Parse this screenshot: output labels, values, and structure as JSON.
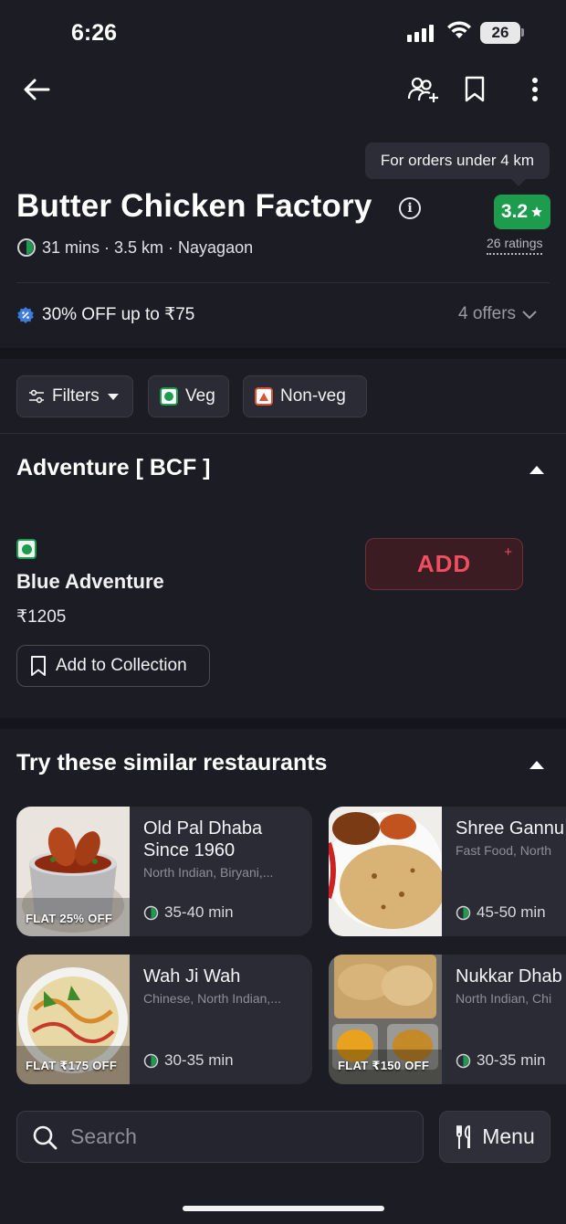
{
  "status_bar": {
    "time": "6:26",
    "battery": "26"
  },
  "tooltip": "For orders under 4 km",
  "restaurant": {
    "name": "Butter Chicken Factory",
    "rating": "3.2",
    "ratings_count": "26 ratings",
    "meta": "31 mins · 3.5 km · Nayagaon",
    "offer": "30% OFF up to ₹75",
    "offers_count": "4 offers"
  },
  "filters": [
    {
      "label": "Filters"
    },
    {
      "label": "Veg"
    },
    {
      "label": "Non-veg"
    }
  ],
  "menu_section": {
    "title": "Adventure [ BCF ]",
    "item": {
      "name": "Blue Adventure",
      "price": "₹1205",
      "add_label": "ADD",
      "add_plus": "+",
      "collection_label": "Add to Collection"
    }
  },
  "similar": {
    "title": "Try these similar restaurants",
    "cards": [
      {
        "name_line1": "Old Pal Dhaba",
        "name_line2": "Since 1960",
        "cuisine": "North Indian, Biryani,...",
        "eta": "35-40 min",
        "offer": "FLAT 25% OFF"
      },
      {
        "name_line1": "Shree Gannu",
        "name_line2": "",
        "cuisine": "Fast Food, North",
        "eta": "45-50 min",
        "offer": ""
      },
      {
        "name_line1": "Wah Ji Wah",
        "name_line2": "",
        "cuisine": "Chinese, North Indian,...",
        "eta": "30-35 min",
        "offer": "FLAT ₹175 OFF"
      },
      {
        "name_line1": "Nukkar Dhab",
        "name_line2": "",
        "cuisine": "North Indian, Chi",
        "eta": "30-35 min",
        "offer": "FLAT ₹150 OFF"
      }
    ]
  },
  "bottom": {
    "search_placeholder": "Search",
    "menu_label": "Menu"
  },
  "colors": {
    "background": "#1c1c24",
    "rating_green": "#1d9c4e",
    "add_red": "#ef4f5f",
    "veg_green": "#1d9c4e",
    "nonveg_red": "#d6543a"
  },
  "icons": [
    "back-arrow-icon",
    "group-order-icon",
    "bookmark-icon",
    "more-vert-icon",
    "info-icon",
    "star-icon",
    "timer-icon",
    "discount-badge-icon",
    "chevron-down-icon",
    "filter-sliders-icon",
    "caret-down-icon",
    "veg-icon",
    "non-veg-icon",
    "collapse-caret-icon",
    "bookmark-outline-icon",
    "search-icon",
    "fork-knife-icon"
  ]
}
